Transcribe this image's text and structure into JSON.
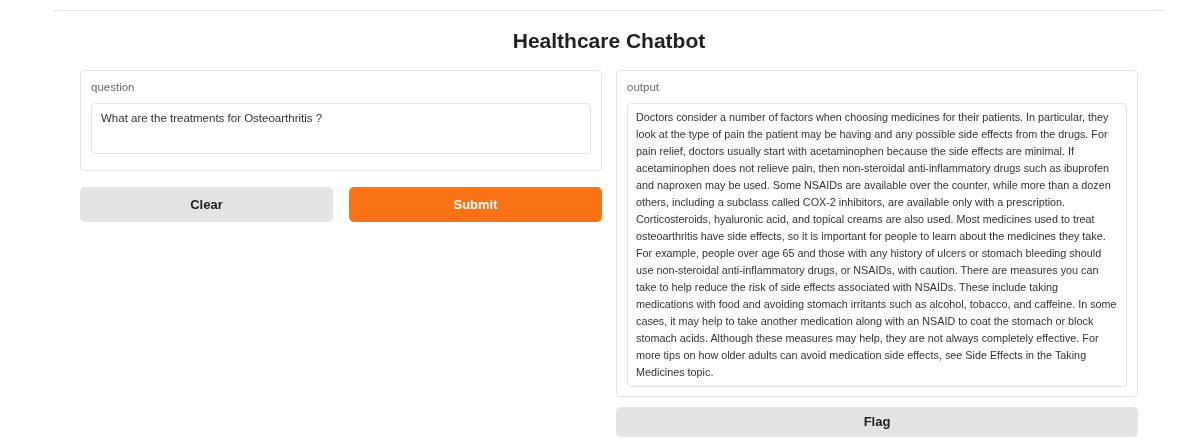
{
  "title": "Healthcare Chatbot",
  "question": {
    "label": "question",
    "value": "What are the treatments for Osteoarthritis ?"
  },
  "buttons": [
    {
      "label": "Clear",
      "kind": "secondary"
    },
    {
      "label": "Submit",
      "kind": "primary"
    }
  ],
  "output": {
    "label": "output",
    "value": "Doctors consider a number of factors when choosing medicines for their patients. In particular, they look at the type of pain the patient may be having and any possible side effects from the drugs. For pain relief, doctors usually start with acetaminophen because the side effects are minimal. If acetaminophen does not relieve pain, then non-steroidal anti-inflammatory drugs such as ibuprofen and naproxen may be used. Some NSAIDs are available over the counter, while more than a dozen others, including a subclass called COX-2 inhibitors, are available only with a prescription. Corticosteroids, hyaluronic acid, and topical creams are also used. Most medicines used to treat osteoarthritis have side effects, so it is important for people to learn about the medicines they take. For example, people over age 65 and those with any history of ulcers or stomach bleeding should use non-steroidal anti-inflammatory drugs, or NSAIDs, with caution. There are measures you can take to help reduce the risk of side effects associated with NSAIDs. These include taking medications with food and avoiding stomach irritants such as alcohol, tobacco, and caffeine. In some cases, it may help to take another medication along with an NSAID to coat the stomach or block stomach acids. Although these measures may help, they are not always completely effective. For more tips on how older adults can avoid medication side effects, see Side Effects in the Taking Medicines topic."
  },
  "flag_button": {
    "label": "Flag"
  }
}
